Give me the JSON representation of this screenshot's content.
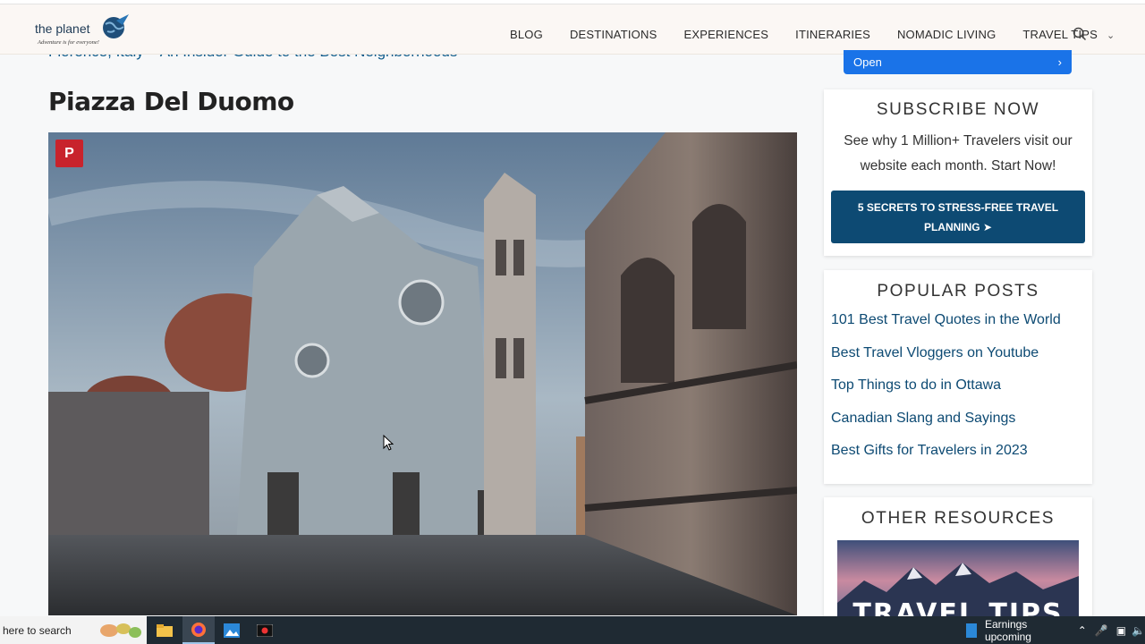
{
  "site": {
    "logo_name": "the planet",
    "logo_tagline": "Adventure is for everyone!"
  },
  "nav": {
    "items": [
      "BLOG",
      "DESTINATIONS",
      "EXPERIENCES",
      "ITINERARIES",
      "NOMADIC LIVING",
      "TRAVEL TIPS"
    ]
  },
  "article": {
    "previous_link": "Florence, Italy – An Insider Guide to the Best Neighborhoods",
    "heading": "Piazza Del Duomo",
    "pin_label": "P"
  },
  "ad": {
    "open_label": "Open"
  },
  "subscribe": {
    "title": "SUBSCRIBE NOW",
    "text": "See why 1 Million+ Travelers visit our website each month. Start Now!",
    "cta_line1": "5 SECRETS TO STRESS-FREE TRAVEL",
    "cta_line2": "PLANNING"
  },
  "popular": {
    "title": "POPULAR POSTS",
    "posts": [
      "101 Best Travel Quotes in the World",
      "Best Travel Vloggers on Youtube",
      "Top Things to do in Ottawa",
      "Canadian Slang and Sayings",
      "Best Gifts for Travelers in 2023"
    ]
  },
  "resources": {
    "title": "OTHER RESOURCES",
    "image_text": "TRAVEL TIPS"
  },
  "taskbar": {
    "search_text": "here to search",
    "news_text": "Earnings upcoming"
  }
}
